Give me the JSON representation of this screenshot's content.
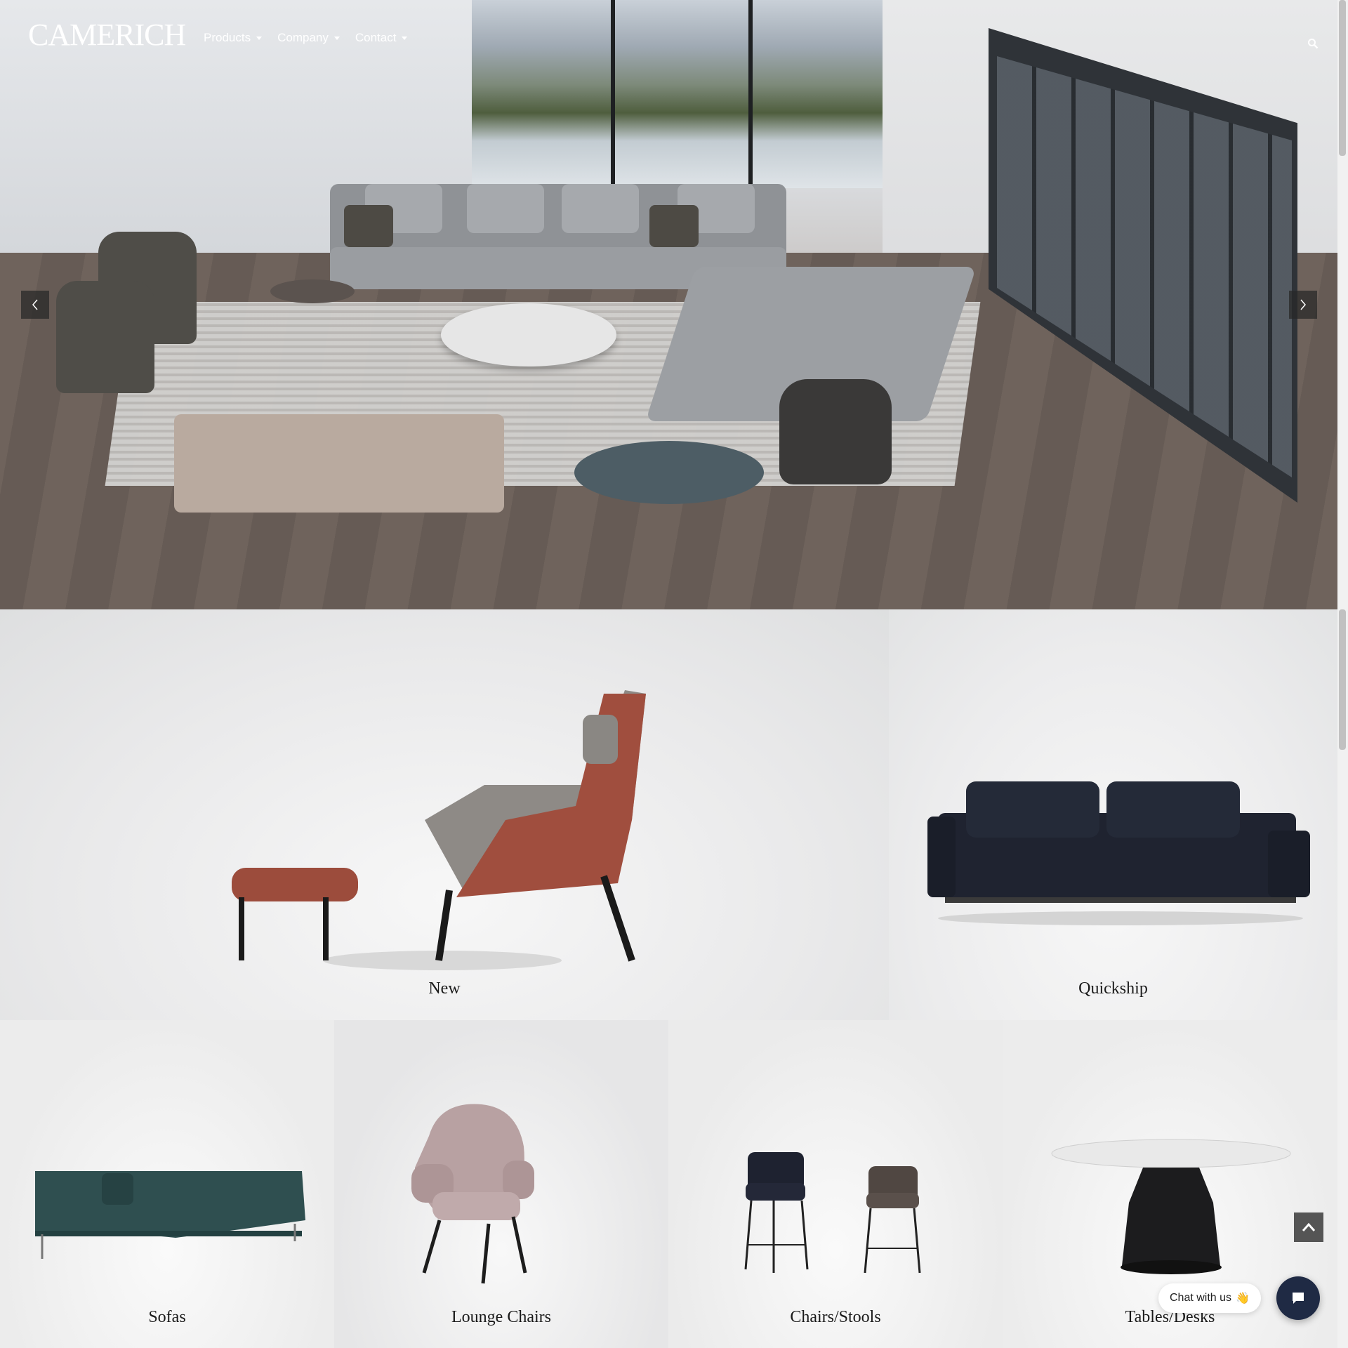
{
  "brand": {
    "logo_text": "CAMERICH"
  },
  "nav": {
    "items": [
      {
        "label": "Products"
      },
      {
        "label": "Company"
      },
      {
        "label": "Contact"
      }
    ]
  },
  "hero": {
    "slider_prev": "‹",
    "slider_next": "›"
  },
  "categories": {
    "new": "New",
    "quickship": "Quickship",
    "sofas": "Sofas",
    "lounge_chairs": "Lounge Chairs",
    "chairs_stools": "Chairs/Stools",
    "tables_desks": "Tables/Desks"
  },
  "chat": {
    "text": "Chat with us",
    "emoji": "👋"
  },
  "icons": {
    "search": "search-icon",
    "back_to_top": "chevron-up-icon",
    "chat": "chat-icon"
  }
}
